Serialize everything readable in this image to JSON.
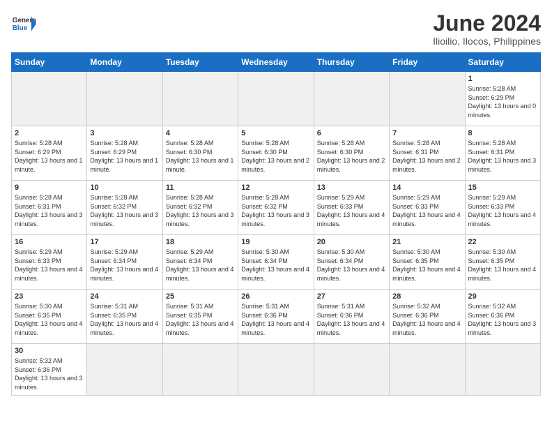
{
  "logo": {
    "text_general": "General",
    "text_blue": "Blue"
  },
  "title": "June 2024",
  "subtitle": "Ilioilio, Ilocos, Philippines",
  "weekdays": [
    "Sunday",
    "Monday",
    "Tuesday",
    "Wednesday",
    "Thursday",
    "Friday",
    "Saturday"
  ],
  "weeks": [
    [
      {
        "day": "",
        "empty": true
      },
      {
        "day": "",
        "empty": true
      },
      {
        "day": "",
        "empty": true
      },
      {
        "day": "",
        "empty": true
      },
      {
        "day": "",
        "empty": true
      },
      {
        "day": "",
        "empty": true
      },
      {
        "day": "1",
        "info": "Sunrise: 5:28 AM\nSunset: 6:29 PM\nDaylight: 13 hours and 0 minutes."
      }
    ],
    [
      {
        "day": "2",
        "info": "Sunrise: 5:28 AM\nSunset: 6:29 PM\nDaylight: 13 hours and 1 minute."
      },
      {
        "day": "3",
        "info": "Sunrise: 5:28 AM\nSunset: 6:29 PM\nDaylight: 13 hours and 1 minute."
      },
      {
        "day": "4",
        "info": "Sunrise: 5:28 AM\nSunset: 6:30 PM\nDaylight: 13 hours and 1 minute."
      },
      {
        "day": "5",
        "info": "Sunrise: 5:28 AM\nSunset: 6:30 PM\nDaylight: 13 hours and 2 minutes."
      },
      {
        "day": "6",
        "info": "Sunrise: 5:28 AM\nSunset: 6:30 PM\nDaylight: 13 hours and 2 minutes."
      },
      {
        "day": "7",
        "info": "Sunrise: 5:28 AM\nSunset: 6:31 PM\nDaylight: 13 hours and 2 minutes."
      },
      {
        "day": "8",
        "info": "Sunrise: 5:28 AM\nSunset: 6:31 PM\nDaylight: 13 hours and 3 minutes."
      }
    ],
    [
      {
        "day": "9",
        "info": "Sunrise: 5:28 AM\nSunset: 6:31 PM\nDaylight: 13 hours and 3 minutes."
      },
      {
        "day": "10",
        "info": "Sunrise: 5:28 AM\nSunset: 6:32 PM\nDaylight: 13 hours and 3 minutes."
      },
      {
        "day": "11",
        "info": "Sunrise: 5:28 AM\nSunset: 6:32 PM\nDaylight: 13 hours and 3 minutes."
      },
      {
        "day": "12",
        "info": "Sunrise: 5:28 AM\nSunset: 6:32 PM\nDaylight: 13 hours and 3 minutes."
      },
      {
        "day": "13",
        "info": "Sunrise: 5:29 AM\nSunset: 6:33 PM\nDaylight: 13 hours and 4 minutes."
      },
      {
        "day": "14",
        "info": "Sunrise: 5:29 AM\nSunset: 6:33 PM\nDaylight: 13 hours and 4 minutes."
      },
      {
        "day": "15",
        "info": "Sunrise: 5:29 AM\nSunset: 6:33 PM\nDaylight: 13 hours and 4 minutes."
      }
    ],
    [
      {
        "day": "16",
        "info": "Sunrise: 5:29 AM\nSunset: 6:33 PM\nDaylight: 13 hours and 4 minutes."
      },
      {
        "day": "17",
        "info": "Sunrise: 5:29 AM\nSunset: 6:34 PM\nDaylight: 13 hours and 4 minutes."
      },
      {
        "day": "18",
        "info": "Sunrise: 5:29 AM\nSunset: 6:34 PM\nDaylight: 13 hours and 4 minutes."
      },
      {
        "day": "19",
        "info": "Sunrise: 5:30 AM\nSunset: 6:34 PM\nDaylight: 13 hours and 4 minutes."
      },
      {
        "day": "20",
        "info": "Sunrise: 5:30 AM\nSunset: 6:34 PM\nDaylight: 13 hours and 4 minutes."
      },
      {
        "day": "21",
        "info": "Sunrise: 5:30 AM\nSunset: 6:35 PM\nDaylight: 13 hours and 4 minutes."
      },
      {
        "day": "22",
        "info": "Sunrise: 5:30 AM\nSunset: 6:35 PM\nDaylight: 13 hours and 4 minutes."
      }
    ],
    [
      {
        "day": "23",
        "info": "Sunrise: 5:30 AM\nSunset: 6:35 PM\nDaylight: 13 hours and 4 minutes."
      },
      {
        "day": "24",
        "info": "Sunrise: 5:31 AM\nSunset: 6:35 PM\nDaylight: 13 hours and 4 minutes."
      },
      {
        "day": "25",
        "info": "Sunrise: 5:31 AM\nSunset: 6:35 PM\nDaylight: 13 hours and 4 minutes."
      },
      {
        "day": "26",
        "info": "Sunrise: 5:31 AM\nSunset: 6:36 PM\nDaylight: 13 hours and 4 minutes."
      },
      {
        "day": "27",
        "info": "Sunrise: 5:31 AM\nSunset: 6:36 PM\nDaylight: 13 hours and 4 minutes."
      },
      {
        "day": "28",
        "info": "Sunrise: 5:32 AM\nSunset: 6:36 PM\nDaylight: 13 hours and 4 minutes."
      },
      {
        "day": "29",
        "info": "Sunrise: 5:32 AM\nSunset: 6:36 PM\nDaylight: 13 hours and 3 minutes."
      }
    ],
    [
      {
        "day": "30",
        "info": "Sunrise: 5:32 AM\nSunset: 6:36 PM\nDaylight: 13 hours and 3 minutes."
      },
      {
        "day": "",
        "empty": true
      },
      {
        "day": "",
        "empty": true
      },
      {
        "day": "",
        "empty": true
      },
      {
        "day": "",
        "empty": true
      },
      {
        "day": "",
        "empty": true
      },
      {
        "day": "",
        "empty": true
      }
    ]
  ]
}
